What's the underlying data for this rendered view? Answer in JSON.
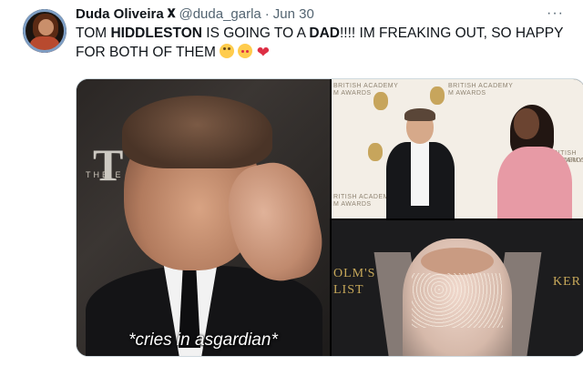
{
  "author": {
    "name": "Duda Oliveira",
    "name_mark": "𝐗",
    "handle": "@duda_garla",
    "separator": "·",
    "date": "Jun 30"
  },
  "more_menu": "···",
  "tweet": {
    "part1": "TOM ",
    "bold1": "HIDDLESTON",
    "part2": " IS GOING TO A ",
    "bold2": "DAD",
    "part3": "!!!! IM FREAKING OUT, SO HAPPY FOR BOTH OF THEM",
    "emojis": [
      "rolling-eyes-emoji",
      "smiling-face-with-hearts-emoji",
      "red-heart-emoji"
    ]
  },
  "media": {
    "gif_caption": "*cries in asgardian*",
    "gif_bg_letters": "T",
    "gif_bg_small": "THE E",
    "top_right_wall": [
      "BRITISH ACADEMY",
      "M AWARDS",
      "BRITISH ACADEMY",
      "M AWARDS",
      "RITISH ACADEMY",
      "M AWARDS",
      "BRITISH ACADEMY",
      "AWARDS"
    ],
    "bottom_right_sign_left": "OLM'S\nLIST",
    "bottom_right_sign_right": "KER"
  }
}
